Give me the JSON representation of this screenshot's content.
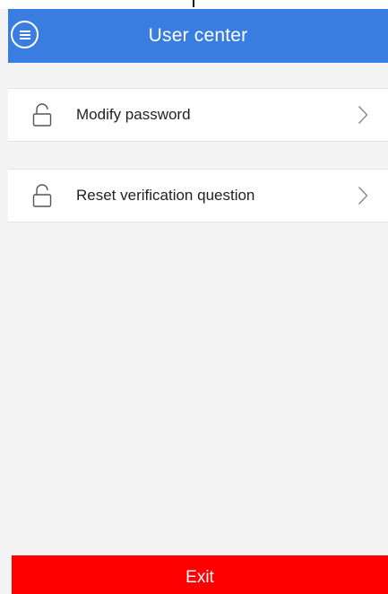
{
  "header": {
    "title": "User center",
    "menu_icon": "menu-circle-icon",
    "background": "#3a7de0"
  },
  "menu": {
    "items": [
      {
        "label": "Modify password",
        "icon": "unlock-icon",
        "trailing_icon": "chevron-right-icon"
      },
      {
        "label": "Reset verification question",
        "icon": "unlock-icon",
        "trailing_icon": "chevron-right-icon"
      }
    ]
  },
  "footer": {
    "exit_label": "Exit",
    "exit_color": "#ff0000"
  }
}
